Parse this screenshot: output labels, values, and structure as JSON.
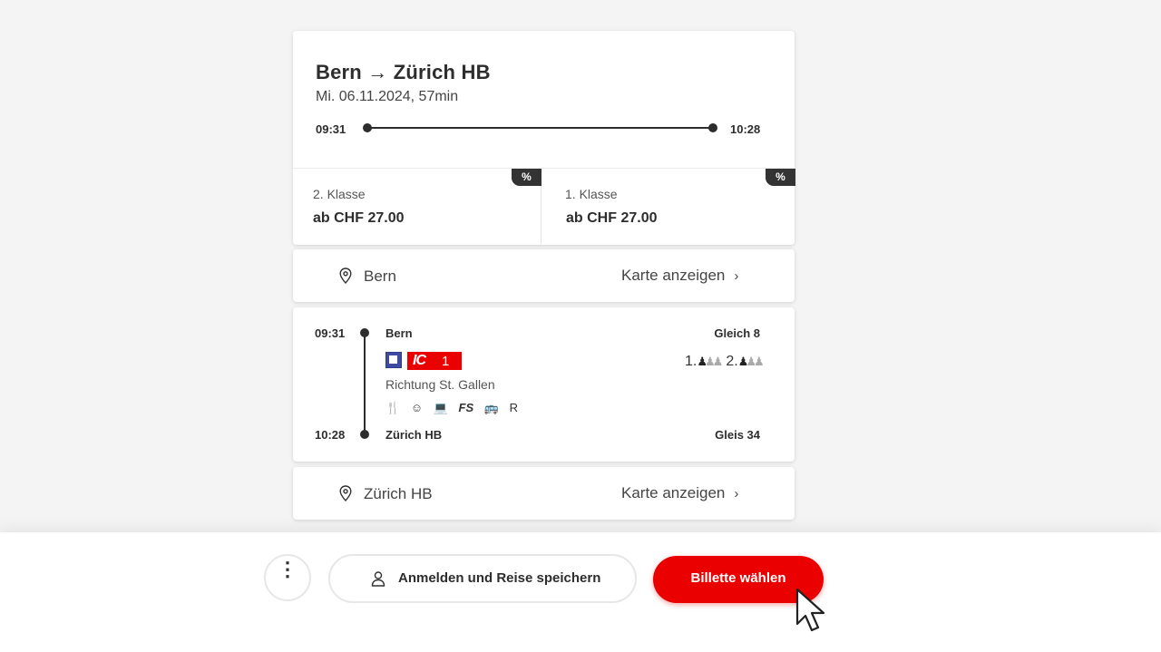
{
  "summary": {
    "title": "Bern → Zürich HB",
    "subtitle": "Mi. 06.11.2024, 57min",
    "departure_time": "09:31",
    "arrival_time": "10:28"
  },
  "prices": [
    {
      "class_label": "2. Klasse",
      "price": "ab CHF 27.00",
      "badge": "%"
    },
    {
      "class_label": "1. Klasse",
      "price": "ab CHF 27.00",
      "badge": "%"
    }
  ],
  "origin": {
    "station": "Bern",
    "map_link": "Karte anzeigen",
    "chevron": "›"
  },
  "destination": {
    "station": "Zürich HB",
    "map_link": "Karte anzeigen",
    "chevron": "›"
  },
  "journey": {
    "dep_time": "09:31",
    "dep_station": "Bern",
    "dep_track": "Gleich 8",
    "train_category": "IC",
    "train_number": "1",
    "direction": "Richtung St. Gallen",
    "amenities": [
      "🍴",
      "☺",
      "💻",
      "FS",
      "🚌",
      "R"
    ],
    "occupancy_first_label": "1.",
    "occupancy_second_label": "2.",
    "arr_time": "10:28",
    "arr_station": "Zürich HB",
    "arr_track": "Gleis 34",
    "icons": [
      "sbb-operator-icon",
      "occupancy-icon"
    ]
  },
  "footer": {
    "more_icon": "⋮",
    "login_label": "Anmelden und Reise speichern",
    "cta_label": "Billette wählen"
  },
  "colors": {
    "accent": "#eb0000",
    "text": "#2d2d2d",
    "badge": "#333333"
  }
}
